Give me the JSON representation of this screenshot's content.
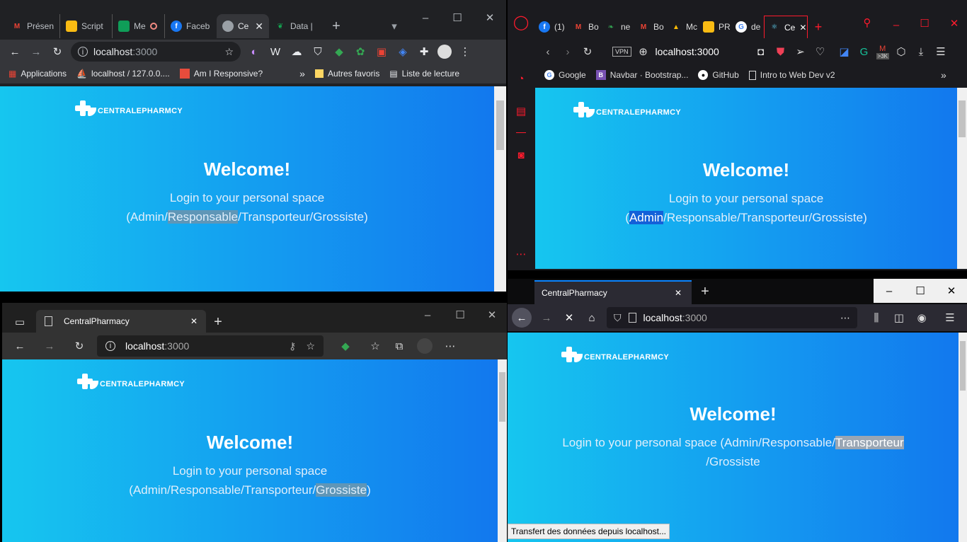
{
  "page": {
    "logo_text": "CENTRALEPHARMCY",
    "welcome": "Welcome!",
    "sub_line1": "Login to your personal space",
    "sub_pre": "(Admin/",
    "roles": [
      "Admin",
      "Responsable",
      "Transporteur",
      "Grossiste"
    ]
  },
  "chrome": {
    "tabs": [
      {
        "label": "Présen",
        "icon": "gmail-icon"
      },
      {
        "label": "Script",
        "icon": "slides-icon"
      },
      {
        "label": "Me",
        "icon": "meet-icon"
      },
      {
        "label": "Faceb",
        "icon": "facebook-icon"
      },
      {
        "label": "Ce",
        "icon": "globe-icon",
        "active": true
      },
      {
        "label": "Data |",
        "icon": "mongodb-icon"
      }
    ],
    "url_host": "localhost",
    "url_port": ":3000",
    "bookmarks": [
      "Applications",
      "localhost / 127.0.0....",
      "Am I Responsive?"
    ],
    "bookmarks_right": [
      "Autres favoris",
      "Liste de lecture"
    ],
    "more": "»"
  },
  "opera": {
    "tabs": [
      {
        "label": "(1)",
        "icon": "facebook-icon"
      },
      {
        "label": "Bo",
        "icon": "gmail-icon"
      },
      {
        "label": "ne",
        "icon": "leaf-icon"
      },
      {
        "label": "Bo",
        "icon": "gmail-icon"
      },
      {
        "label": "Mc",
        "icon": "drive-icon"
      },
      {
        "label": "PR",
        "icon": "slides-icon"
      },
      {
        "label": "de",
        "icon": "google-icon"
      },
      {
        "label": "Ce",
        "icon": "react-icon",
        "active": true
      }
    ],
    "vpn": "VPN",
    "url": "localhost:3000",
    "badge": ">3K",
    "bookmarks": [
      "Google",
      "Navbar · Bootstrap...",
      "GitHub",
      "Intro to Web Dev v2"
    ],
    "more": "»"
  },
  "edge": {
    "tab_title": "CentralPharmacy",
    "url_host": "localhost",
    "url_port": ":3000"
  },
  "firefox": {
    "tab_title": "CentralPharmacy",
    "url_host": "localhost",
    "url_port": ":3000",
    "status": "Transfert des données depuis localhost..."
  },
  "colors": {
    "gradient_start": "#16c6ef",
    "gradient_end": "#1278ee",
    "chrome_dark": "#202124",
    "opera_accent": "#ff1b2d"
  }
}
